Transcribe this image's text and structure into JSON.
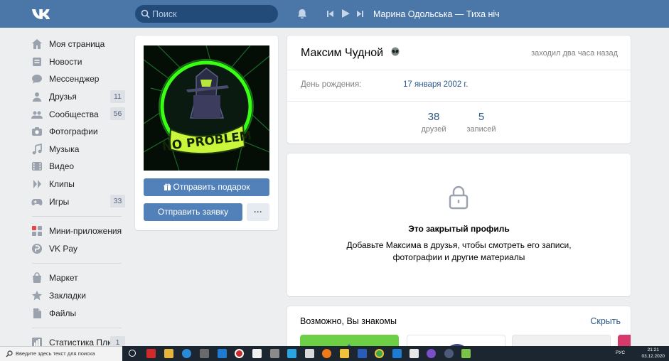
{
  "header": {
    "search_placeholder": "Поиск",
    "now_playing": "Марина Одольська — Тиха ніч"
  },
  "sidebar": {
    "items": [
      {
        "label": "Моя страница",
        "icon": "home-icon"
      },
      {
        "label": "Новости",
        "icon": "news-icon"
      },
      {
        "label": "Мессенджер",
        "icon": "messenger-icon"
      },
      {
        "label": "Друзья",
        "icon": "friends-icon",
        "count": "11"
      },
      {
        "label": "Сообщества",
        "icon": "communities-icon",
        "count": "56"
      },
      {
        "label": "Фотографии",
        "icon": "camera-icon"
      },
      {
        "label": "Музыка",
        "icon": "music-icon"
      },
      {
        "label": "Видео",
        "icon": "video-icon"
      },
      {
        "label": "Клипы",
        "icon": "clips-icon"
      },
      {
        "label": "Игры",
        "icon": "gamepad-icon",
        "count": "33"
      }
    ],
    "items2": [
      {
        "label": "Мини-приложения",
        "icon": "apps-icon"
      },
      {
        "label": "VK Pay",
        "icon": "vkpay-icon"
      }
    ],
    "items3": [
      {
        "label": "Маркет",
        "icon": "market-icon"
      },
      {
        "label": "Закладки",
        "icon": "star-icon"
      },
      {
        "label": "Файлы",
        "icon": "file-icon"
      }
    ],
    "items4": [
      {
        "label": "Статистика Плюс",
        "icon": "stats-icon",
        "count": "1"
      }
    ]
  },
  "profile": {
    "avatar_text": "NO PROBLEM",
    "gift_button": "Отправить подарок",
    "request_button": "Отправить заявку",
    "more_button": "···",
    "name": "Максим Чудной",
    "last_seen": "заходил два часа назад",
    "birthday_label": "День рождения:",
    "birthday_value": "17 января 2002 г.",
    "stats": [
      {
        "value": "38",
        "label": "друзей"
      },
      {
        "value": "5",
        "label": "записей"
      }
    ]
  },
  "closed": {
    "title": "Это закрытый профиль",
    "text": "Добавьте Максима в друзья, чтобы смотреть его записи, фотографии и другие материалы"
  },
  "suggestions": {
    "title": "Возможно, Вы знакомы",
    "hide": "Скрыть"
  },
  "taskbar": {
    "search_placeholder": "Введите здесь текст для поиска",
    "lang": "РУС",
    "time": "21:21",
    "date": "03.12.2020"
  },
  "colors": {
    "header": "#4a76a8",
    "link": "#2a5885",
    "button": "#5181b8"
  }
}
